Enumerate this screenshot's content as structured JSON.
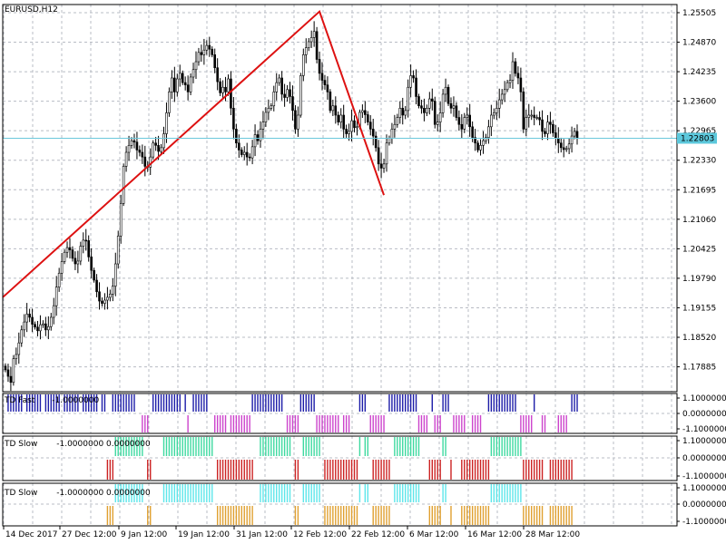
{
  "symbol_label": "EURUSD,H12",
  "current_price_label": "1.22803",
  "price_axis": {
    "ticks": [
      "1.25505",
      "1.24870",
      "1.24235",
      "1.23600",
      "1.22965",
      "1.22330",
      "1.21695",
      "1.21060",
      "1.20425",
      "1.19790",
      "1.19155",
      "1.18520",
      "1.17885"
    ],
    "range": [
      1.1735,
      1.2568
    ],
    "current_price": 1.22803
  },
  "time_axis": {
    "labels": [
      "14 Dec 2017",
      "27 Dec 12:00",
      "9 Jan 12:00",
      "19 Jan 12:00",
      "31 Jan 12:00",
      "12 Feb 12:00",
      "22 Feb 12:00",
      "6 Mar 12:00",
      "16 Mar 12:00",
      "28 Mar 12:00"
    ]
  },
  "trendline_points": [
    {
      "bar": 0,
      "price": 1.1938
    },
    {
      "bar": 117,
      "price": 1.2553
    },
    {
      "bar": 141,
      "price": 1.2158
    }
  ],
  "indicators": [
    {
      "name": "TD Fast",
      "value_text": "-1.0000000",
      "scale": [
        "1.1000000",
        "0.0000000",
        "-1.1000000"
      ],
      "up_color": "#1c1ca8",
      "down_color": "#cc44cc"
    },
    {
      "name": "TD Slow",
      "value_text": "-1.0000000 0.0000000",
      "scale": [
        "1.1000000",
        "0.0000000",
        "-1.1000000"
      ],
      "up_color": "#3dd9a0",
      "down_color": "#cc2222"
    },
    {
      "name": "TD Slow",
      "value_text": "-1.0000000 0.0000000",
      "scale": [
        "1.1000000",
        "0.0000000",
        "-1.1000000"
      ],
      "up_color": "#5ce6ea",
      "down_color": "#e0a030"
    }
  ],
  "chart_data": {
    "type": "candlestick",
    "title": "EURUSD,H12",
    "ylim": [
      1.1735,
      1.2568
    ],
    "series": [
      {
        "name": "EURUSD",
        "values": [
          1.1782,
          1.1768,
          1.1755,
          1.1806,
          1.1815,
          1.184,
          1.1868,
          1.1885,
          1.1902,
          1.1895,
          1.188,
          1.1874,
          1.1866,
          1.1879,
          1.1881,
          1.1868,
          1.1875,
          1.1895,
          1.192,
          1.196,
          1.199,
          1.2015,
          1.2035,
          1.2045,
          1.204,
          1.2022,
          1.201,
          1.2016,
          1.2048,
          1.2061,
          1.206,
          1.2025,
          1.1996,
          1.1975,
          1.195,
          1.193,
          1.1925,
          1.1932,
          1.1938,
          1.1945,
          1.1962,
          1.201,
          1.207,
          1.214,
          1.222,
          1.225,
          1.2265,
          1.2275,
          1.2272,
          1.2255,
          1.225,
          1.224,
          1.222,
          1.2218,
          1.224,
          1.227,
          1.2265,
          1.2252,
          1.226,
          1.229,
          1.2335,
          1.238,
          1.241,
          1.238,
          1.2408,
          1.242,
          1.24,
          1.2395,
          1.238,
          1.2412,
          1.2428,
          1.2445,
          1.2465,
          1.246,
          1.247,
          1.248,
          1.2472,
          1.246,
          1.2432,
          1.2402,
          1.2378,
          1.239,
          1.238,
          1.2408,
          1.2345,
          1.23,
          1.227,
          1.2255,
          1.2245,
          1.225,
          1.224,
          1.2238,
          1.2262,
          1.2288,
          1.2275,
          1.23,
          1.2315,
          1.2336,
          1.2345,
          1.235,
          1.238,
          1.24,
          1.241,
          1.2375,
          1.2368,
          1.2385,
          1.237,
          1.234,
          1.23,
          1.233,
          1.2415,
          1.246,
          1.2475,
          1.2488,
          1.2497,
          1.251,
          1.245,
          1.242,
          1.2405,
          1.2395,
          1.238,
          1.234,
          1.235,
          1.233,
          1.2315,
          1.233,
          1.23,
          1.229,
          1.2295,
          1.2318,
          1.2303,
          1.2305,
          1.2336,
          1.234,
          1.2331,
          1.2315,
          1.23,
          1.2285,
          1.226,
          1.2225,
          1.2216,
          1.2225,
          1.227,
          1.228,
          1.23,
          1.231,
          1.2325,
          1.2345,
          1.233,
          1.234,
          1.239,
          1.2415,
          1.241,
          1.237,
          1.235,
          1.2345,
          1.2335,
          1.2345,
          1.2365,
          1.236,
          1.231,
          1.2315,
          1.2335,
          1.2375,
          1.239,
          1.2355,
          1.2345,
          1.235,
          1.2325,
          1.231,
          1.23,
          1.2325,
          1.233,
          1.2305,
          1.2282,
          1.227,
          1.2255,
          1.2265,
          1.2275,
          1.2282,
          1.2305,
          1.233,
          1.2335,
          1.2345,
          1.2363,
          1.2375,
          1.2385,
          1.24,
          1.2405,
          1.2445,
          1.242,
          1.241,
          1.238,
          1.23,
          1.2325,
          1.233,
          1.233,
          1.2325,
          1.2325,
          1.232,
          1.2295,
          1.229,
          1.2315,
          1.231,
          1.2292,
          1.228,
          1.227,
          1.226,
          1.2256,
          1.2258,
          1.2268,
          1.2285,
          1.2295,
          1.228
        ]
      }
    ]
  }
}
